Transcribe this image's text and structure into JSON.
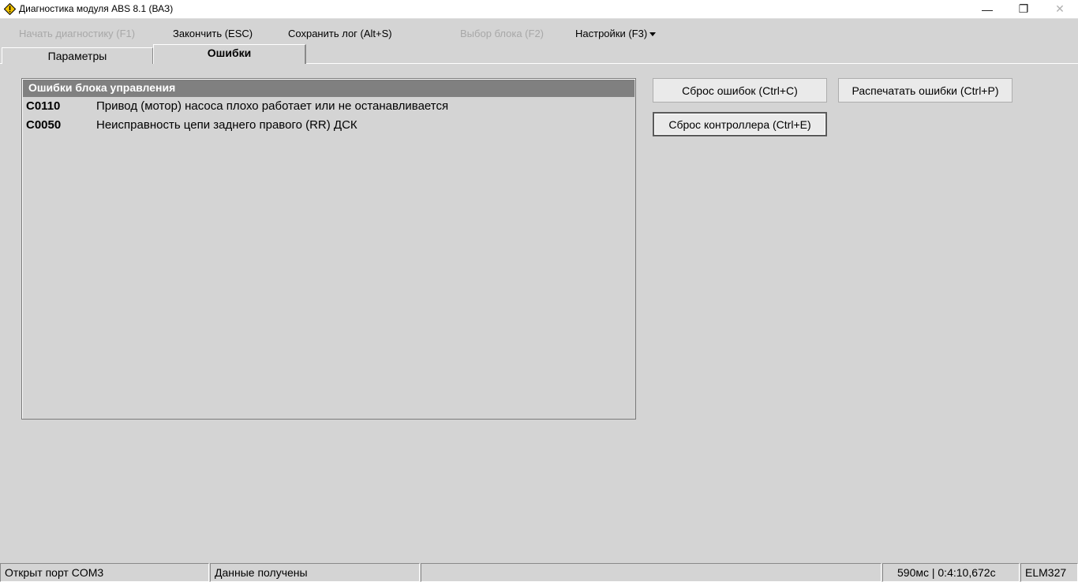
{
  "window": {
    "title": "Диагностика модуля ABS 8.1 (ВАЗ)",
    "minimize_glyph": "—",
    "restore_glyph": "❐",
    "close_glyph": "✕"
  },
  "menu": {
    "start": "Начать диагностику (F1)",
    "finish": "Закончить (ESC)",
    "save_log": "Сохранить лог (Alt+S)",
    "select_block": "Выбор блока (F2)",
    "settings": "Настройки (F3)"
  },
  "tabs": [
    {
      "label": "Параметры",
      "active": false
    },
    {
      "label": "Ошибки",
      "active": true
    }
  ],
  "errors_panel": {
    "header": "Ошибки блока управления",
    "rows": [
      {
        "code": "C0110",
        "description": "Привод (мотор) насоса плохо работает или не останавливается"
      },
      {
        "code": "C0050",
        "description": "Неисправность цепи заднего правого (RR) ДСК"
      }
    ]
  },
  "buttons": {
    "reset_errors": "Сброс ошибок (Ctrl+C)",
    "print_errors": "Распечатать ошибки (Ctrl+P)",
    "reset_controller": "Сброс контроллера (Ctrl+E)"
  },
  "status": {
    "port": "Открыт порт COM3",
    "data": "Данные получены",
    "empty": "",
    "timing": "590мс | 0:4:10,672с",
    "adapter": "ELM327"
  },
  "colors": {
    "background": "#d4d4d4",
    "panel_header": "#808080",
    "disabled_text": "#a8a8a8"
  },
  "icons": {
    "app": "warning-diamond-icon",
    "menu_dropdown": "caret-down-icon"
  }
}
